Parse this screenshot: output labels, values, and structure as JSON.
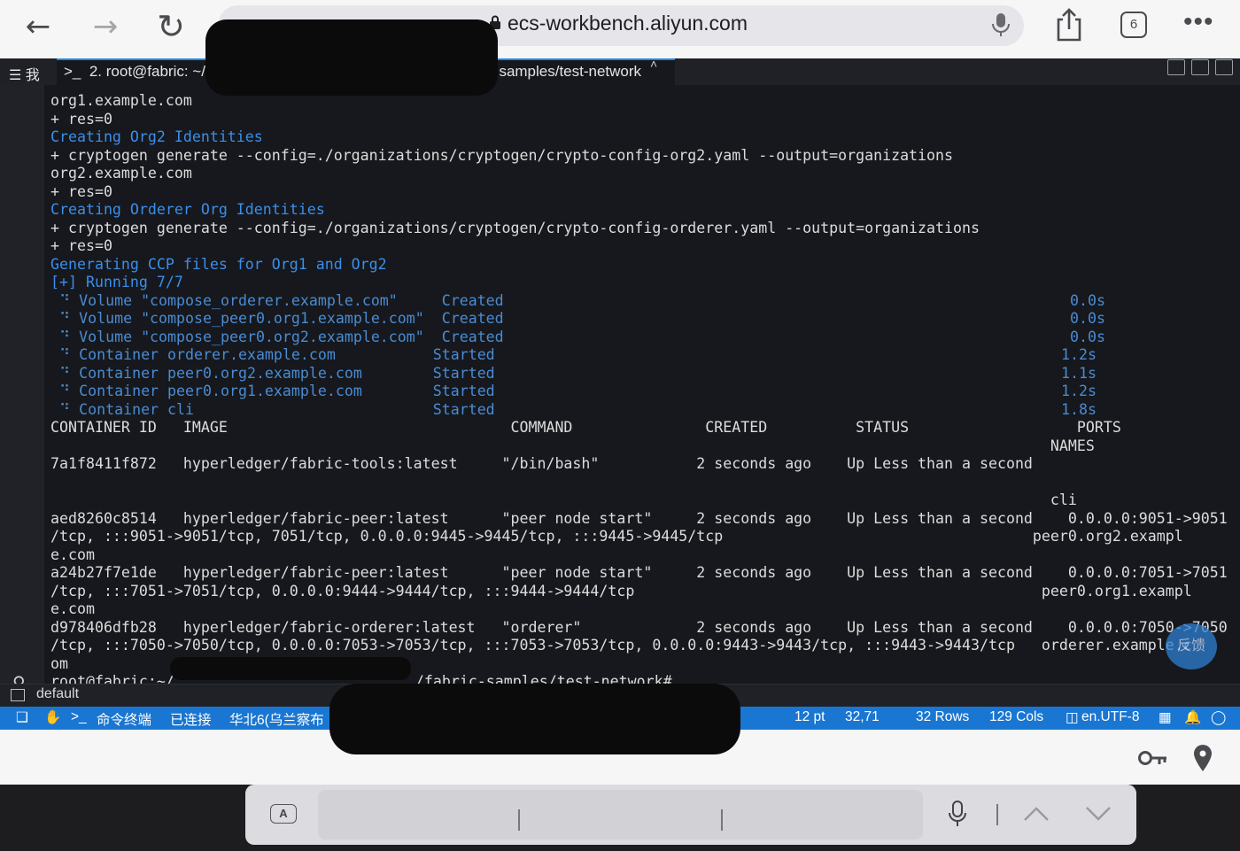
{
  "browser": {
    "url": "ecs-workbench.aliyun.com",
    "tab_count": "6",
    "icons": [
      "back-arrow-icon",
      "forward-arrow-icon",
      "reload-icon",
      "lock-icon",
      "microphone-icon",
      "share-icon",
      "tabs-icon",
      "more-icon"
    ]
  },
  "terminal_app": {
    "menu_label": "我",
    "tab_title": "2. root@fabric: ~/",
    "tab_title_tail": "samples/test-network",
    "tab_close": "˄",
    "panel_name": "default",
    "feedback_label": "反馈",
    "status": {
      "terminal_label": "命令终端",
      "connected": "已连接",
      "region": "华北6(乌兰察布",
      "font_size": "12 pt",
      "cursor": "32,71",
      "rows": "32 Rows",
      "cols": "129 Cols",
      "encoding": "en.UTF-8"
    }
  },
  "terminal": {
    "lines": [
      {
        "text": "org1.example.com",
        "style": "normal"
      },
      {
        "text": "+ res=0",
        "style": "normal"
      },
      {
        "text": "Creating Org2 Identities",
        "style": "cyan"
      },
      {
        "text": "+ cryptogen generate --config=./organizations/cryptogen/crypto-config-org2.yaml --output=organizations",
        "style": "normal"
      },
      {
        "text": "org2.example.com",
        "style": "normal"
      },
      {
        "text": "+ res=0",
        "style": "normal"
      },
      {
        "text": "Creating Orderer Org Identities",
        "style": "cyan"
      },
      {
        "text": "+ cryptogen generate --config=./organizations/cryptogen/crypto-config-orderer.yaml --output=organizations",
        "style": "normal"
      },
      {
        "text": "+ res=0",
        "style": "normal"
      },
      {
        "text": "Generating CCP files for Org1 and Org2",
        "style": "cyan"
      },
      {
        "text": "[+] Running 7/7",
        "style": "cyan"
      },
      {
        "text": " ⠙ Volume \"compose_orderer.example.com\"     Created                                                                0.0s",
        "style": "dim"
      },
      {
        "text": " ⠙ Volume \"compose_peer0.org1.example.com\"  Created                                                                0.0s",
        "style": "dim"
      },
      {
        "text": " ⠙ Volume \"compose_peer0.org2.example.com\"  Created                                                                0.0s",
        "style": "dim"
      },
      {
        "text": " ⠙ Container orderer.example.com           Started                                                                1.2s",
        "style": "dim"
      },
      {
        "text": " ⠙ Container peer0.org2.example.com        Started                                                                1.1s",
        "style": "dim"
      },
      {
        "text": " ⠙ Container peer0.org1.example.com        Started                                                                1.2s",
        "style": "dim"
      },
      {
        "text": " ⠙ Container cli                           Started                                                                1.8s",
        "style": "dim"
      },
      {
        "text": "CONTAINER ID   IMAGE                                COMMAND               CREATED          STATUS                   PORTS",
        "style": "normal"
      },
      {
        "text": "                                                                                                                 NAMES",
        "style": "normal"
      },
      {
        "text": "7a1f8411f872   hyperledger/fabric-tools:latest     \"/bin/bash\"           2 seconds ago    Up Less than a second",
        "style": "normal"
      },
      {
        "text": "",
        "style": "normal"
      },
      {
        "text": "                                                                                                                 cli",
        "style": "normal"
      },
      {
        "text": "aed8260c8514   hyperledger/fabric-peer:latest      \"peer node start\"     2 seconds ago    Up Less than a second    0.0.0.0:9051->9051",
        "style": "normal"
      },
      {
        "text": "/tcp, :::9051->9051/tcp, 7051/tcp, 0.0.0.0:9445->9445/tcp, :::9445->9445/tcp                                   peer0.org2.exampl",
        "style": "normal"
      },
      {
        "text": "e.com",
        "style": "normal"
      },
      {
        "text": "a24b27f7e1de   hyperledger/fabric-peer:latest      \"peer node start\"     2 seconds ago    Up Less than a second    0.0.0.0:7051->7051",
        "style": "normal"
      },
      {
        "text": "/tcp, :::7051->7051/tcp, 0.0.0.0:9444->9444/tcp, :::9444->9444/tcp                                              peer0.org1.exampl",
        "style": "normal"
      },
      {
        "text": "e.com",
        "style": "normal"
      },
      {
        "text": "d978406dfb28   hyperledger/fabric-orderer:latest   \"orderer\"             2 seconds ago    Up Less than a second    0.0.0.0:7050->7050",
        "style": "normal"
      },
      {
        "text": "/tcp, :::7050->7050/tcp, 0.0.0.0:7053->7053/tcp, :::7053->7053/tcp, 0.0.0.0:9443->9443/tcp, :::9443->9443/tcp   orderer.example.c",
        "style": "normal"
      },
      {
        "text": "om",
        "style": "normal"
      },
      {
        "text": "root@fabric:~/",
        "style": "normal"
      }
    ],
    "prompt_tail": "/fabric-samples/test-network#"
  }
}
